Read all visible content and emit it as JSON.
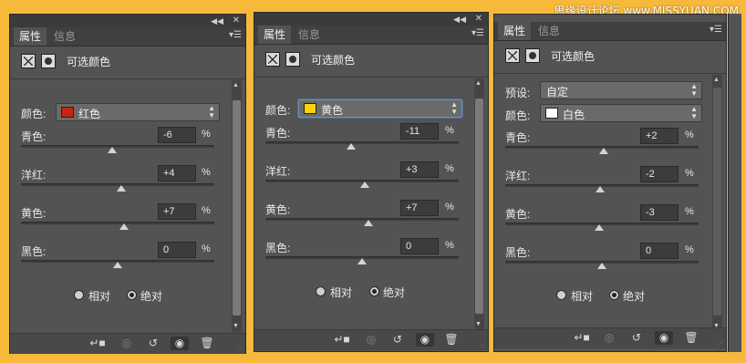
{
  "watermark": "思缘设计论坛 www.MISSYUAN.COM",
  "icons": {
    "collapse": "double-chevron-left-icon",
    "close": "close-icon",
    "panel_menu": "menu-icon",
    "image_adjust": "adjustment-layer-icon",
    "mask": "layer-mask-icon",
    "clip": "clip-to-layer-icon",
    "view_previous": "view-previous-state-icon",
    "reset": "reset-icon",
    "visibility": "eye-icon",
    "delete": "trash-icon"
  },
  "colors": {
    "background": "#f6b93b",
    "panel": "#535353",
    "red_swatch": "#c8240f",
    "yellow_swatch": "#ffd400",
    "white_swatch": "#ffffff"
  },
  "panels": [
    {
      "tab_active": "属性",
      "tab_inactive": "信息",
      "title": "可选颜色",
      "preset_label": "",
      "preset_value": "",
      "color_label": "颜色:",
      "color_value": "红色",
      "rows": [
        {
          "label": "青色:",
          "value": "-6",
          "unit": "%",
          "level": -6
        },
        {
          "label": "洋红:",
          "value": "+4",
          "unit": "%",
          "level": 4
        },
        {
          "label": "黄色:",
          "value": "+7",
          "unit": "%",
          "level": 7
        },
        {
          "label": "黑色:",
          "value": "0",
          "unit": "%",
          "level": 0
        }
      ],
      "method_relative": "相对",
      "method_absolute": "绝对",
      "method_selected": "绝对"
    },
    {
      "tab_active": "属性",
      "tab_inactive": "信息",
      "title": "可选颜色",
      "preset_label": "",
      "preset_value": "",
      "color_label": "颜色:",
      "color_value": "黄色",
      "rows": [
        {
          "label": "青色:",
          "value": "-11",
          "unit": "%",
          "level": -11
        },
        {
          "label": "洋红:",
          "value": "+3",
          "unit": "%",
          "level": 3
        },
        {
          "label": "黄色:",
          "value": "+7",
          "unit": "%",
          "level": 7
        },
        {
          "label": "黑色:",
          "value": "0",
          "unit": "%",
          "level": 0
        }
      ],
      "method_relative": "相对",
      "method_absolute": "绝对",
      "method_selected": "绝对"
    },
    {
      "tab_active": "属性",
      "tab_inactive": "信息",
      "title": "可选颜色",
      "preset_label": "预设:",
      "preset_value": "自定",
      "color_label": "颜色:",
      "color_value": "白色",
      "rows": [
        {
          "label": "青色:",
          "value": "+2",
          "unit": "%",
          "level": 2
        },
        {
          "label": "洋红:",
          "value": "-2",
          "unit": "%",
          "level": -2
        },
        {
          "label": "黄色:",
          "value": "-3",
          "unit": "%",
          "level": -3
        },
        {
          "label": "黑色:",
          "value": "0",
          "unit": "%",
          "level": 0
        }
      ],
      "method_relative": "相对",
      "method_absolute": "绝对",
      "method_selected": "绝对"
    }
  ]
}
